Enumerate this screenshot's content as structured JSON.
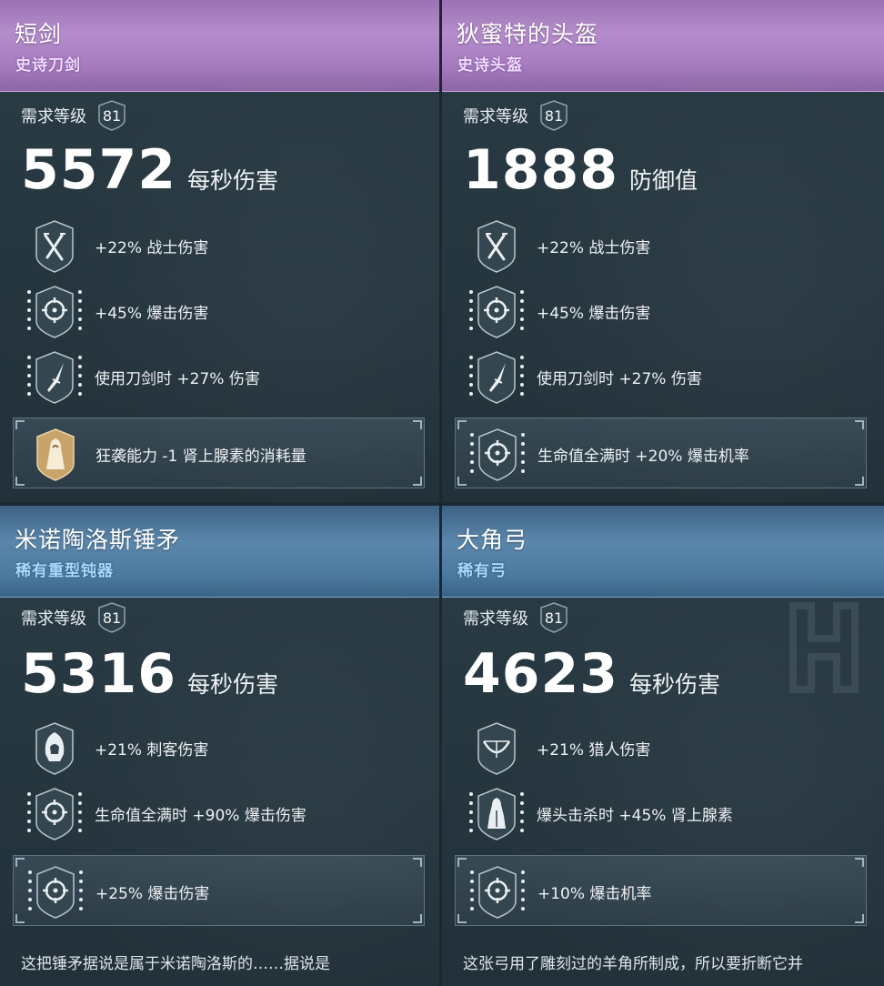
{
  "cards": [
    {
      "title": "短剑",
      "subtitle": "史诗刀剑",
      "rarity": "epic",
      "req_label": "需求等级",
      "req_level": "81",
      "main_value": "5572",
      "main_unit": "每秒伤害",
      "perks": [
        {
          "icon": "crossed-daggers-icon",
          "text": "+22% 战士伤害"
        },
        {
          "icon": "crosshair-icon",
          "text": "+45% 爆击伤害"
        },
        {
          "icon": "spearhead-icon",
          "text": "使用刀剑时 +27% 伤害"
        }
      ],
      "special": {
        "icon": "hooded-figure-icon",
        "text": "狂袭能力 -1 肾上腺素的消耗量"
      }
    },
    {
      "title": "狄蜜特的头盔",
      "subtitle": "史诗头盔",
      "rarity": "epic",
      "req_label": "需求等级",
      "req_level": "81",
      "main_value": "1888",
      "main_unit": "防御值",
      "perks": [
        {
          "icon": "crossed-daggers-icon",
          "text": "+22% 战士伤害"
        },
        {
          "icon": "crosshair-icon",
          "text": "+45% 爆击伤害"
        },
        {
          "icon": "spearhead-icon",
          "text": "使用刀剑时 +27% 伤害"
        }
      ],
      "special": {
        "icon": "crosshair-icon",
        "text": "生命值全满时 +20% 爆击机率"
      }
    },
    {
      "title": "米诺陶洛斯锤矛",
      "subtitle": "稀有重型钝器",
      "rarity": "rare",
      "req_label": "需求等级",
      "req_level": "81",
      "main_value": "5316",
      "main_unit": "每秒伤害",
      "perks": [
        {
          "icon": "assassin-hood-icon",
          "text": "+21% 刺客伤害"
        },
        {
          "icon": "crosshair-icon",
          "text": "生命值全满时 +90% 爆击伤害"
        }
      ],
      "special": {
        "icon": "crosshair-icon",
        "text": "+25% 爆击伤害"
      },
      "description": "这把锤矛据说是属于米诺陶洛斯的……据说是"
    },
    {
      "title": "大角弓",
      "subtitle": "稀有弓",
      "rarity": "rare",
      "req_label": "需求等级",
      "req_level": "81",
      "main_value": "4623",
      "main_unit": "每秒伤害",
      "perks": [
        {
          "icon": "bow-icon",
          "text": "+21% 猎人伤害"
        },
        {
          "icon": "cloaked-figure-icon",
          "text": "爆头击杀时 +45% 肾上腺素"
        }
      ],
      "special": {
        "icon": "crosshair-icon",
        "text": "+10% 爆击机率"
      },
      "description": "这张弓用了雕刻过的羊角所制成，所以要折断它并"
    }
  ],
  "colors": {
    "epic_header": "#a77dc0",
    "rare_header": "#4d7aa0",
    "panel": "#26363f"
  }
}
